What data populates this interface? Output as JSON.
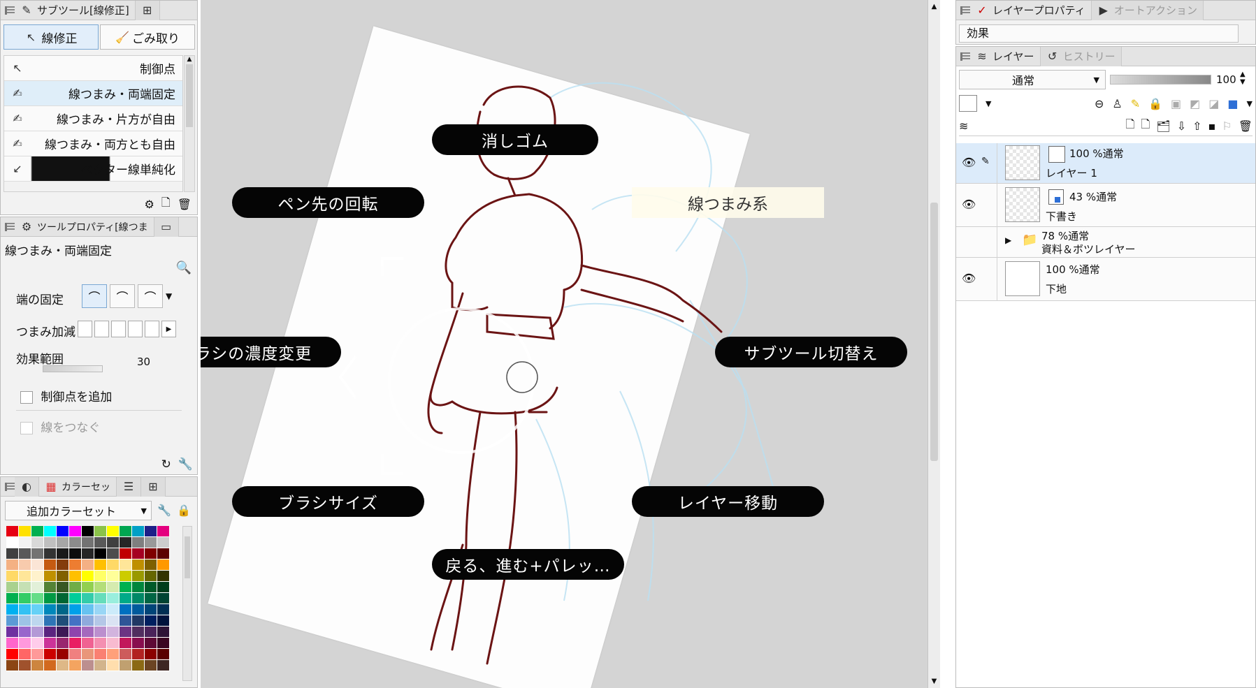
{
  "subtool_panel": {
    "tab_label": "サブツール[線修正]",
    "group_buttons": [
      {
        "label": "線修正",
        "icon": "line-correct-icon"
      },
      {
        "label": "ごみ取り",
        "icon": "broom-icon"
      }
    ],
    "items": [
      {
        "label": "制御点",
        "icon": "control-point-icon",
        "selected": false
      },
      {
        "label": "線つまみ・両端固定",
        "icon": "pinch-icon",
        "selected": true
      },
      {
        "label": "線つまみ・片方が自由",
        "icon": "pinch-icon",
        "selected": false
      },
      {
        "label": "線つまみ・両方とも自由",
        "icon": "pinch-icon",
        "selected": false
      },
      {
        "label": "ベクター線単純化",
        "icon": "simplify-icon",
        "selected": false
      }
    ]
  },
  "tool_property_panel": {
    "tab_label": "ツールプロパティ[線つま",
    "tool_name": "線つまみ・両端固定",
    "fix_ends_label": "端の固定",
    "pinch_label": "つまみ加減",
    "range_label": "効果範囲",
    "range_value": "30",
    "add_control_point_label": "制御点を追加",
    "connect_lines_label": "線をつなぐ"
  },
  "color_set_panel": {
    "tab_label": "カラーセッ",
    "set_name": "追加カラーセット",
    "colors": [
      "#e60012",
      "#ffe100",
      "#00b050",
      "#00ffff",
      "#0000ff",
      "#ff00ff",
      "#000000",
      "#8bc34a",
      "#ffff00",
      "#00a651",
      "#00a0c6",
      "#1d2088",
      "#e4007f",
      "#ffffff",
      "#f2f2f2",
      "#d9d9d9",
      "#bfbfbf",
      "#a6a6a6",
      "#8c8c8c",
      "#737373",
      "#595959",
      "#404040",
      "#262626",
      "#7f7f7f",
      "#999999",
      "#cccccc",
      "#404040",
      "#595959",
      "#737373",
      "#333333",
      "#1a1a1a",
      "#0d0d0d",
      "#262626",
      "#000000",
      "#4d4d4d",
      "#c00000",
      "#a50021",
      "#800000",
      "#5c0000",
      "#f4b183",
      "#f8cbad",
      "#fbe5d6",
      "#c55a11",
      "#843c0c",
      "#ed7d31",
      "#f4b084",
      "#ffc000",
      "#ffd966",
      "#ffe699",
      "#bf8f00",
      "#7f6000",
      "#ff9900",
      "#ffd966",
      "#ffe699",
      "#fff2cc",
      "#bf9000",
      "#806000",
      "#ffc000",
      "#ffff00",
      "#ffff66",
      "#ffff99",
      "#cccc00",
      "#999900",
      "#666600",
      "#333300",
      "#a9d18e",
      "#c5e0b4",
      "#e2f0d9",
      "#548235",
      "#385723",
      "#70ad47",
      "#92d050",
      "#b4de7a",
      "#d5ebaf",
      "#00b050",
      "#00863d",
      "#005a29",
      "#003d1c",
      "#00b050",
      "#33cc66",
      "#66dd88",
      "#009944",
      "#006633",
      "#00cc99",
      "#33ccaa",
      "#66ddbb",
      "#99eedd",
      "#00aa88",
      "#008866",
      "#006644",
      "#004433",
      "#00b0f0",
      "#33c1f3",
      "#66d1f6",
      "#0088bb",
      "#006688",
      "#00a0e9",
      "#66c2f0",
      "#99d6f5",
      "#ccebfa",
      "#0070c0",
      "#005a9c",
      "#004578",
      "#002f54",
      "#5b9bd5",
      "#9dc3e6",
      "#bdd7ee",
      "#2e75b6",
      "#1f4e79",
      "#4472c4",
      "#8faadc",
      "#b4c7e7",
      "#dae3f3",
      "#2f5597",
      "#203864",
      "#002060",
      "#00133d",
      "#7030a0",
      "#9966cc",
      "#b399d6",
      "#5b2480",
      "#3d1856",
      "#8e44ad",
      "#a569bd",
      "#bb8fce",
      "#d2b4de",
      "#6c3483",
      "#512e5f",
      "#4a235a",
      "#2e1437",
      "#ff66cc",
      "#ff99dd",
      "#ffcceb",
      "#cc3399",
      "#99266f",
      "#e91e63",
      "#f06292",
      "#f48fb1",
      "#f8bbd0",
      "#c2185b",
      "#880e4f",
      "#5e0a36",
      "#3a0622",
      "#ff0000",
      "#ff6666",
      "#ff9999",
      "#cc0000",
      "#990000",
      "#f08080",
      "#e9967a",
      "#fa8072",
      "#ffa07a",
      "#cd5c5c",
      "#b22222",
      "#8b0000",
      "#5a0000",
      "#8b4513",
      "#a0522d",
      "#cd853f",
      "#d2691e",
      "#deb887",
      "#f4a460",
      "#bc8f8f",
      "#d2b48c",
      "#ffdead",
      "#c0a070",
      "#8b6914",
      "#6b4423",
      "#3e2723"
    ]
  },
  "canvas": {
    "pie_labels": {
      "top": "消しゴム",
      "top_left": "ペン先の回転",
      "top_right": "線つまみ系",
      "left": "ブラシの濃度変更",
      "right": "サブツール切替え",
      "bottom_left": "ブラシサイズ",
      "bottom_right": "レイヤー移動",
      "bottom": "戻る、進む+パレッ…"
    }
  },
  "layer_property_panel": {
    "tab_active": "レイヤープロパティ",
    "tab_inactive": "オートアクション",
    "effect_label": "効果"
  },
  "layer_panel": {
    "tab_active": "レイヤー",
    "tab_inactive": "ヒストリー",
    "blend_mode": "通常",
    "opacity": "100",
    "layers": [
      {
        "meta": "100 %通常",
        "name": "レイヤー 1",
        "selected": true,
        "visible": true,
        "type": "raster"
      },
      {
        "meta": "43 %通常",
        "name": "下書き",
        "selected": false,
        "visible": true,
        "type": "vector"
      },
      {
        "meta": "78 %通常",
        "name": "資料＆ボツレイヤー",
        "selected": false,
        "visible": false,
        "type": "folder"
      },
      {
        "meta": "100 %通常",
        "name": "下地",
        "selected": false,
        "visible": true,
        "type": "paper"
      }
    ]
  },
  "colors": {
    "accent_blue": "#dcebfa",
    "panel_bg": "#f2f2f2",
    "canvas_bg": "#d4d4d4",
    "pill_bg": "#050505",
    "line_art": "#6b1414"
  }
}
